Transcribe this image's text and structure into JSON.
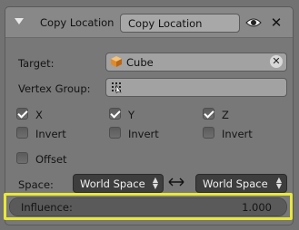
{
  "header": {
    "title": "Copy Location",
    "name_value": "Copy Location",
    "collapse_icon": "disclosure-triangle-icon",
    "visibility_icon": "eye-icon",
    "delete_icon": "close-icon",
    "delete_glyph": "✕"
  },
  "target": {
    "label": "Target:",
    "value": "Cube",
    "object_icon": "cube-icon",
    "clear_glyph": "✕"
  },
  "vertex_group": {
    "label": "Vertex Group:",
    "value": "",
    "icon": "vertex-group-icon"
  },
  "axes": [
    {
      "label": "X",
      "checked": true
    },
    {
      "label": "Y",
      "checked": true
    },
    {
      "label": "Z",
      "checked": true
    }
  ],
  "invert": [
    {
      "label": "Invert",
      "checked": false
    },
    {
      "label": "Invert",
      "checked": false
    },
    {
      "label": "Invert",
      "checked": false
    }
  ],
  "offset": {
    "label": "Offset",
    "checked": false
  },
  "space": {
    "label": "Space:",
    "owner": "World Space",
    "target": "World Space",
    "swap_icon": "swap-arrows-icon"
  },
  "influence": {
    "label": "Influence:",
    "value": "1.000",
    "fraction": 1.0
  },
  "colors": {
    "highlight": "#e8e83a",
    "panel_bg": "#787878",
    "dropdown_bg": "#3e3e3e"
  }
}
